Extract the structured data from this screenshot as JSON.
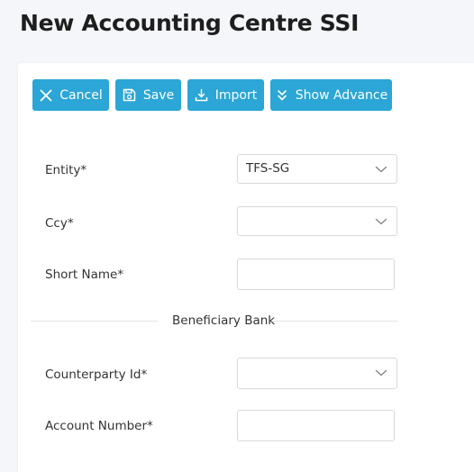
{
  "page": {
    "title": "New Accounting Centre SSI"
  },
  "toolbar": {
    "cancel_label": "Cancel",
    "save_label": "Save",
    "import_label": "Import",
    "advance_label": "Show Advance"
  },
  "form": {
    "entity": {
      "label": "Entity*",
      "value": "TFS-SG"
    },
    "ccy": {
      "label": "Ccy*",
      "value": ""
    },
    "short_name": {
      "label": "Short Name*",
      "value": ""
    },
    "section_beneficiary": "Beneficiary Bank",
    "counterparty_id": {
      "label": "Counterparty Id*",
      "value": ""
    },
    "account_number": {
      "label": "Account Number*",
      "value": ""
    }
  },
  "icons": {
    "cancel": "close-icon",
    "save": "save-icon",
    "import": "download-icon",
    "advance": "double-chevron-down-icon",
    "dropdown": "chevron-down-icon"
  },
  "colors": {
    "primary": "#2ba6d6",
    "background": "#f4f6f9",
    "card": "#ffffff",
    "border": "#d9d9d9"
  }
}
